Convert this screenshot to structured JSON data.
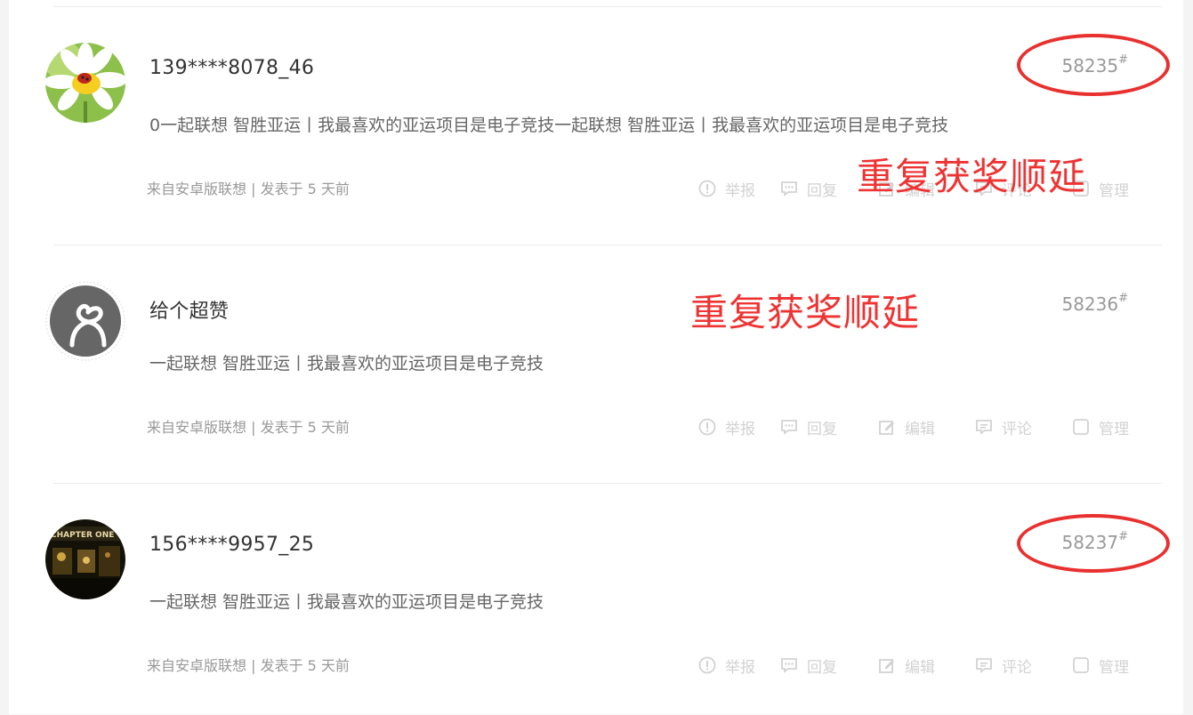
{
  "posts": [
    {
      "username": "139****8078_46",
      "content": "0一起联想 智胜亚运丨我最喜欢的亚运项目是电子竞技一起联想 智胜亚运丨我最喜欢的亚运项目是电子竞技",
      "floor": "58235",
      "floor_mark": "#",
      "meta": "来自安卓版联想 | 发表于 5 天前",
      "avatar_icon": "daisy-ladybug-avatar",
      "highlighted_floor": true
    },
    {
      "username": "给个超赞",
      "content": "一起联想 智胜亚运丨我最喜欢的亚运项目是电子竞技",
      "floor": "58236",
      "floor_mark": "#",
      "meta": "来自安卓版联想 | 发表于 5 天前",
      "avatar_icon": "default-gray-avatar",
      "highlighted_floor": false
    },
    {
      "username": "156****9957_25",
      "content": "一起联想 智胜亚运丨我最喜欢的亚运项目是电子竞技",
      "floor": "58237",
      "floor_mark": "#",
      "meta": "来自安卓版联想 | 发表于 5 天前",
      "avatar_icon": "night-storefront-avatar",
      "highlighted_floor": true
    }
  ],
  "actions": {
    "report": "举报",
    "reply": "回复",
    "edit": "编辑",
    "comment": "评论",
    "manage": "管理"
  },
  "annotations": {
    "note_1": "重复获奖顺延",
    "note_2": "重复获奖顺延"
  },
  "colors": {
    "annotation_red": "#ee3333",
    "action_gray": "#d2d2d2"
  }
}
